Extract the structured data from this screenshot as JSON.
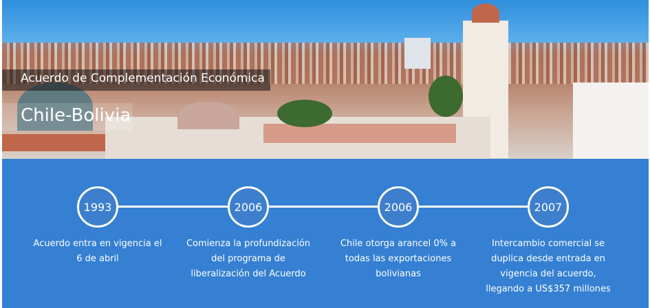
{
  "header": {
    "subtitle": "Acuerdo de Complementación Económica",
    "title": "Chile-Bolivia"
  },
  "timeline": [
    {
      "year": "1993",
      "text": "Acuerdo entra en vigencia el 6 de abril"
    },
    {
      "year": "2006",
      "text": "Comienza la profundización del programa de liberalización del Acuerdo"
    },
    {
      "year": "2006",
      "text": "Chile otorga arancel 0% a todas las exportaciones bolivianas"
    },
    {
      "year": "2007",
      "text": "Intercambio comercial se duplica desde entrada en vigencia del acuerdo, llegando a US$357 millones"
    }
  ],
  "colors": {
    "panel": "#3580d2",
    "sky": "#2f8fdc"
  }
}
